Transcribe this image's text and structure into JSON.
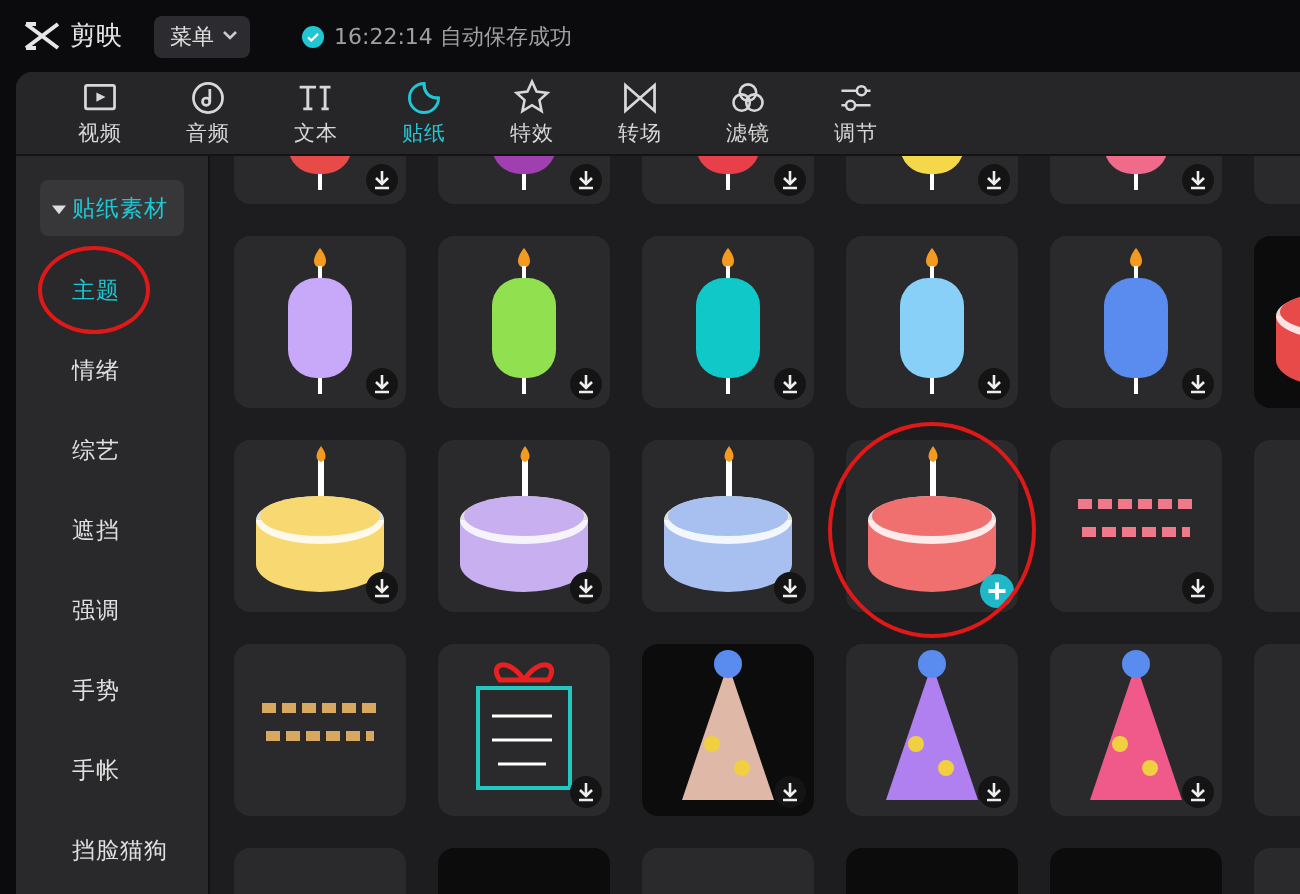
{
  "app": {
    "name": "剪映",
    "menu_button": "菜单",
    "save_status": "16:22:14 自动保存成功"
  },
  "tabs": [
    {
      "label": "视频",
      "selected": false
    },
    {
      "label": "音频",
      "selected": false
    },
    {
      "label": "文本",
      "selected": false
    },
    {
      "label": "贴纸",
      "selected": true
    },
    {
      "label": "特效",
      "selected": false
    },
    {
      "label": "转场",
      "selected": false
    },
    {
      "label": "滤镜",
      "selected": false
    },
    {
      "label": "调节",
      "selected": false
    }
  ],
  "sidebar": {
    "header": {
      "label": "贴纸素材",
      "expanded": true
    },
    "items": [
      {
        "label": "主题",
        "selected": true,
        "circled": true
      },
      {
        "label": "情绪",
        "selected": false,
        "circled": false
      },
      {
        "label": "综艺",
        "selected": false,
        "circled": false
      },
      {
        "label": "遮挡",
        "selected": false,
        "circled": false
      },
      {
        "label": "强调",
        "selected": false,
        "circled": false
      },
      {
        "label": "手势",
        "selected": false,
        "circled": false
      },
      {
        "label": "手帐",
        "selected": false,
        "circled": false
      },
      {
        "label": "挡脸猫狗",
        "selected": false,
        "circled": false
      }
    ]
  },
  "stickers": [
    {
      "kind": "candle",
      "color": "#e84a4a",
      "download_button": true,
      "add_button": false,
      "dark": false,
      "circled": false
    },
    {
      "kind": "candle",
      "color": "#a040b0",
      "download_button": true,
      "add_button": false,
      "dark": false,
      "circled": false
    },
    {
      "kind": "candle",
      "color": "#e8404a",
      "download_button": true,
      "add_button": false,
      "dark": false,
      "circled": false
    },
    {
      "kind": "candle",
      "color": "#f5d84a",
      "download_button": true,
      "add_button": false,
      "dark": false,
      "circled": false
    },
    {
      "kind": "candle",
      "color": "#f06a8a",
      "download_button": true,
      "add_button": false,
      "dark": false,
      "circled": false
    },
    {
      "kind": "partial",
      "download_button": false,
      "add_button": false,
      "dark": false,
      "circled": false
    },
    {
      "kind": "candle",
      "color": "#c8a8f8",
      "download_button": true,
      "add_button": false,
      "dark": false,
      "circled": false
    },
    {
      "kind": "candle",
      "color": "#90e050",
      "download_button": true,
      "add_button": false,
      "dark": false,
      "circled": false
    },
    {
      "kind": "candle",
      "color": "#10c8c8",
      "download_button": true,
      "add_button": false,
      "dark": false,
      "circled": false
    },
    {
      "kind": "candle",
      "color": "#88d0f8",
      "download_button": true,
      "add_button": false,
      "dark": false,
      "circled": false
    },
    {
      "kind": "candle",
      "color": "#5a8cf0",
      "download_button": true,
      "add_button": false,
      "dark": false,
      "circled": false
    },
    {
      "kind": "cake",
      "color": "#e84a4a",
      "download_button": false,
      "add_button": false,
      "dark": true,
      "circled": false
    },
    {
      "kind": "cake",
      "color": "#f8d870",
      "download_button": true,
      "add_button": false,
      "dark": false,
      "circled": false
    },
    {
      "kind": "cake",
      "color": "#c8b0f0",
      "download_button": true,
      "add_button": false,
      "dark": false,
      "circled": false
    },
    {
      "kind": "cake",
      "color": "#a8c0f0",
      "download_button": true,
      "add_button": false,
      "dark": false,
      "circled": false
    },
    {
      "kind": "cake",
      "color": "#f07070",
      "download_button": false,
      "add_button": true,
      "dark": false,
      "circled": true
    },
    {
      "kind": "banner",
      "color": "#f07888",
      "download_button": true,
      "add_button": false,
      "dark": false,
      "circled": false
    },
    {
      "kind": "partial",
      "download_button": false,
      "add_button": false,
      "dark": false,
      "circled": false
    },
    {
      "kind": "banner",
      "color": "#d8a860",
      "download_button": false,
      "add_button": false,
      "dark": false,
      "circled": false
    },
    {
      "kind": "gift",
      "color": "#e82020",
      "download_button": true,
      "add_button": false,
      "dark": false,
      "circled": false
    },
    {
      "kind": "hat",
      "color": "#e0b8a8",
      "download_button": true,
      "add_button": false,
      "dark": true,
      "circled": false
    },
    {
      "kind": "hat",
      "color": "#b080f0",
      "download_button": true,
      "add_button": false,
      "dark": false,
      "circled": false
    },
    {
      "kind": "hat",
      "color": "#f05a8a",
      "download_button": true,
      "add_button": false,
      "dark": false,
      "circled": false
    },
    {
      "kind": "partial",
      "download_button": false,
      "add_button": false,
      "dark": false,
      "circled": false
    },
    {
      "kind": "partial",
      "download_button": false,
      "add_button": false,
      "dark": false,
      "circled": false
    },
    {
      "kind": "partial",
      "download_button": false,
      "add_button": false,
      "dark": true,
      "circled": false
    },
    {
      "kind": "partial",
      "download_button": false,
      "add_button": false,
      "dark": false,
      "circled": false
    },
    {
      "kind": "partial",
      "download_button": false,
      "add_button": false,
      "dark": true,
      "circled": false
    },
    {
      "kind": "partial",
      "download_button": false,
      "add_button": false,
      "dark": true,
      "circled": false
    },
    {
      "kind": "partial",
      "download_button": false,
      "add_button": false,
      "dark": false,
      "circled": false
    }
  ]
}
